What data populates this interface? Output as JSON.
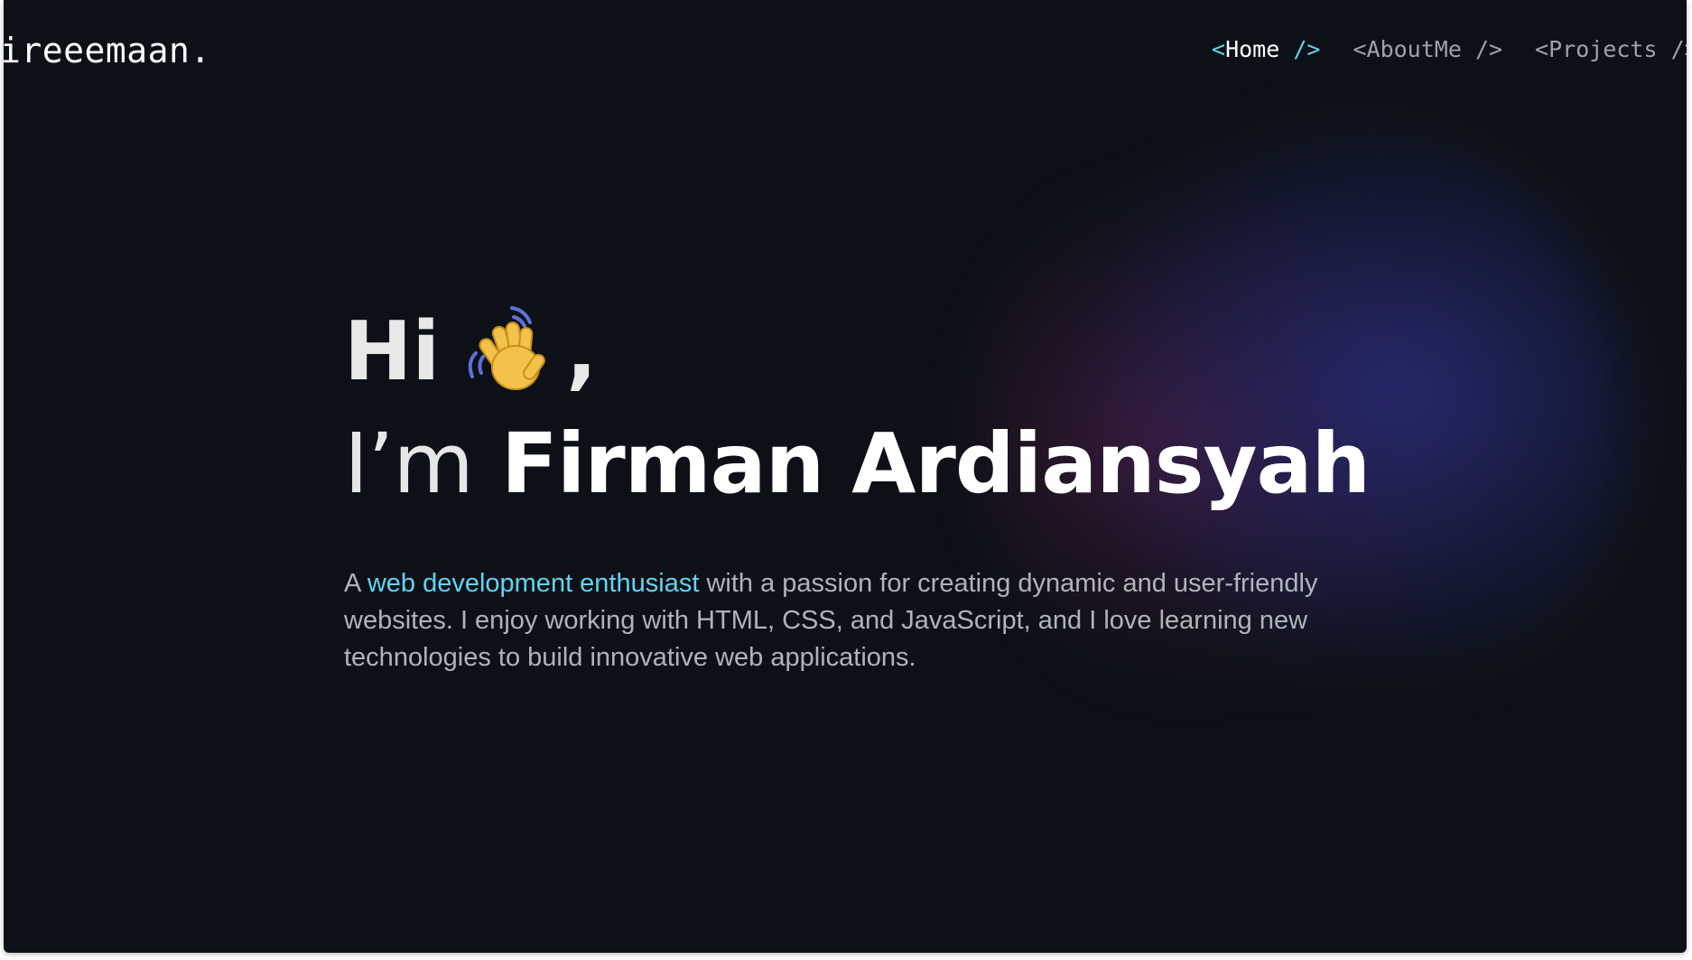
{
  "navbar": {
    "logo": "ireeemaan.",
    "links": [
      {
        "lt": "<",
        "name": "Home",
        "close": "/>",
        "active": true
      },
      {
        "lt": "<",
        "name": "AboutMe",
        "close": "/>",
        "active": false
      },
      {
        "lt": "<",
        "name": "Projects",
        "close": "/>",
        "active": false
      }
    ]
  },
  "hero": {
    "greeting": "Hi",
    "greeting_suffix": ",",
    "wave_icon": "waving-hand-icon",
    "im_prefix": "I’m",
    "name": "Firman Ardiansyah",
    "desc_prefix": "A",
    "desc_highlight": "web development enthusiast",
    "desc_rest": "with a passion for creating dynamic and user-friendly websites. I enjoy working with HTML, CSS, and JavaScript, and I love learning new technologies to build innovative web applications."
  },
  "colors": {
    "background": "#0d1117",
    "accent": "#61d4f0",
    "text_muted": "#b0b4ba"
  }
}
